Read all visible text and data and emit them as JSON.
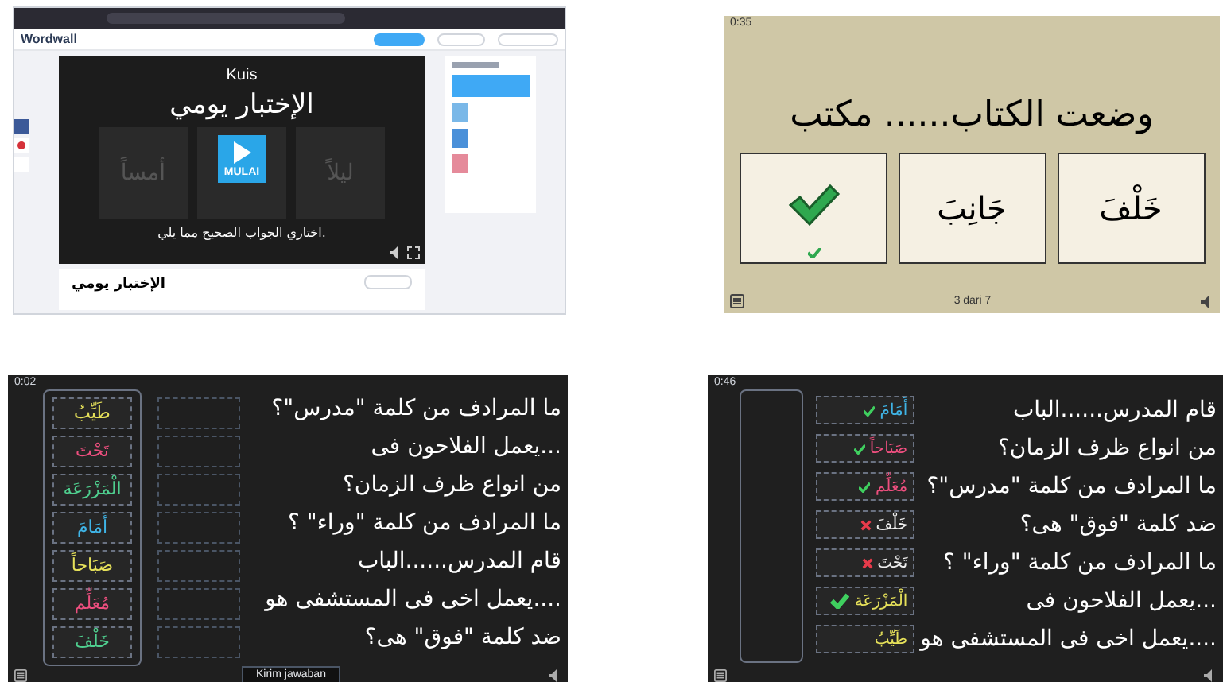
{
  "quiz_start": {
    "brand": "Wordwall",
    "quiz_type": "Kuis",
    "title": "الإختبار يومي",
    "background_options": [
      "ليلاً",
      "أمساً"
    ],
    "start_button": "MULAI",
    "instruction": "اختاري الجواب الصحيح مما يلي.",
    "activity_title": "الإختبار يومي"
  },
  "quiz_question": {
    "timer": "0:35",
    "question": "وضعت الكتاب...... مكتب",
    "options": [
      {
        "label": "خَلْفَ",
        "correct": false
      },
      {
        "label": "جَانِبَ",
        "correct": false
      },
      {
        "correct": true
      }
    ],
    "progress": "3 dari 7"
  },
  "matching_game": {
    "timer": "0:02",
    "answers": [
      {
        "label": "طَيِّبُ",
        "color": "#e6e15a"
      },
      {
        "label": "تَحْتَ",
        "color": "#ee4f7f"
      },
      {
        "label": "الْمَزْرَعَة",
        "color": "#4fcf8f"
      },
      {
        "label": "أَمَامَ",
        "color": "#3fb4e6"
      },
      {
        "label": "صَبَاحاً",
        "color": "#e6e15a"
      },
      {
        "label": "مُعَلِّم",
        "color": "#ee4f7f"
      },
      {
        "label": "خَلْفَ",
        "color": "#4fcf8f"
      }
    ],
    "questions": [
      "ما المرادف من كلمة \"مدرس\"؟",
      "يعمل الفلاحون فى...",
      "من انواع ظرف الزمان؟",
      "ما المرادف من كلمة \"وراء\" ؟",
      "قام المدرس......الباب",
      "يعمل اخى فى المستشفى هو....",
      "ضد كلمة \"فوق\" هى؟"
    ],
    "submit_button": "Kirim jawaban"
  },
  "matching_results": {
    "timer": "0:46",
    "rows": [
      {
        "question": "قام المدرس......الباب",
        "answer": "أَمَامَ",
        "color": "#3fb4e6",
        "kind": "correct"
      },
      {
        "question": "من انواع ظرف الزمان؟",
        "answer": "صَبَاحاً",
        "color": "#ee4f7f",
        "kind": "correct"
      },
      {
        "question": "ما المرادف من كلمة \"مدرس\"؟",
        "answer": "مُعَلِّم",
        "color": "#ee4f7f",
        "kind": "correct"
      },
      {
        "question": "ضد كلمة \"فوق\" هى؟",
        "answer": "خَلْفَ",
        "color": "#f0f0f0",
        "kind": "wrong"
      },
      {
        "question": "ما المرادف من كلمة \"وراء\" ؟",
        "answer": "تَحْتَ",
        "color": "#f0f0f0",
        "kind": "wrong"
      },
      {
        "question": "يعمل الفلاحون فى...",
        "answer": "الْمَزْرَعَة",
        "color": "#e6e15a",
        "kind": "correct_big"
      },
      {
        "question": "يعمل اخى فى المستشفى هو....",
        "answer": "طَيِّبُ",
        "color": "#e6e15a",
        "kind": "pending"
      }
    ]
  }
}
